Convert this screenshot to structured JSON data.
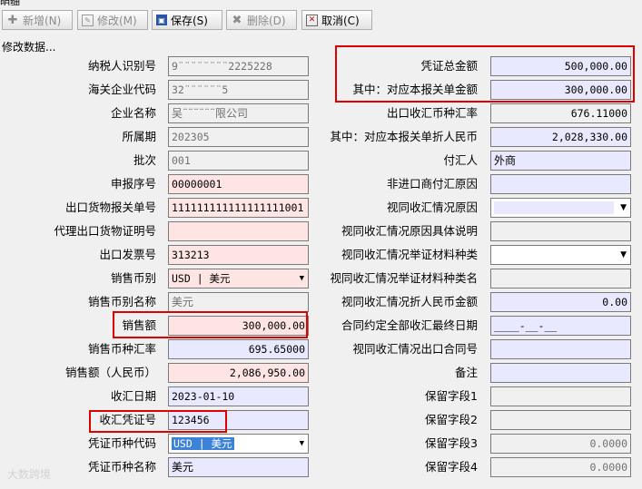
{
  "window": {
    "title": "明细"
  },
  "toolbar": {
    "add_label": "新增(N)",
    "edit_label": "修改(M)",
    "save_label": "保存(S)",
    "delete_label": "删除(D)",
    "cancel_label": "取消(C)"
  },
  "status_text": "修改数据...",
  "left_fields": [
    {
      "label": "纳税人识别号",
      "value": "9¨¨¨¨¨¨¨¨2225228"
    },
    {
      "label": "海关企业代码",
      "value": "32¨¨¨¨¨¨5"
    },
    {
      "label": "企业名称",
      "value": "吴¨¨¨¨¨¨限公司"
    },
    {
      "label": "所属期",
      "value": "202305"
    },
    {
      "label": "批次",
      "value": "001"
    },
    {
      "label": "申报序号",
      "value": "00000001"
    },
    {
      "label": "出口货物报关单号",
      "value": "111111111111111111001"
    },
    {
      "label": "代理出口货物证明号",
      "value": ""
    },
    {
      "label": "出口发票号",
      "value": "313213"
    },
    {
      "label": "销售币别",
      "value": "USD | 美元"
    },
    {
      "label": "销售币别名称",
      "value": "美元"
    },
    {
      "label": "销售额",
      "value": "300,000.00"
    },
    {
      "label": "销售币种汇率",
      "value": "695.65000"
    },
    {
      "label": "销售额（人民币）",
      "value": "2,086,950.00"
    },
    {
      "label": "收汇日期",
      "value": "2023-01-10"
    },
    {
      "label": "收汇凭证号",
      "value": "123456"
    },
    {
      "label": "凭证币种代码",
      "value": "USD | 美元"
    },
    {
      "label": "凭证币种名称",
      "value": "美元"
    }
  ],
  "right_fields": [
    {
      "label": "凭证总金额",
      "value": "500,000.00"
    },
    {
      "label": "其中：对应本报关单金额",
      "value": "300,000.00"
    },
    {
      "label": "出口收汇币种汇率",
      "value": "676.11000"
    },
    {
      "label": "其中：对应本报关单折人民币",
      "value": "2,028,330.00"
    },
    {
      "label": "付汇人",
      "value": "外商"
    },
    {
      "label": "非进口商付汇原因",
      "value": ""
    },
    {
      "label": "视同收汇情况原因",
      "value": ""
    },
    {
      "label": "视同收汇情况原因具体说明",
      "value": ""
    },
    {
      "label": "视同收汇情况举证材料种类",
      "value": ""
    },
    {
      "label": "视同收汇情况举证材料种类名",
      "value": ""
    },
    {
      "label": "视同收汇情况折人民币金额",
      "value": "0.00"
    },
    {
      "label": "合同约定全部收汇最终日期",
      "value": "____-__-__"
    },
    {
      "label": "视同收汇情况出口合同号",
      "value": ""
    },
    {
      "label": "备注",
      "value": ""
    },
    {
      "label": "保留字段1",
      "value": ""
    },
    {
      "label": "保留字段2",
      "value": ""
    },
    {
      "label": "保留字段3",
      "value": "0.0000"
    },
    {
      "label": "保留字段4",
      "value": "0.0000"
    }
  ],
  "colors": {
    "highlight": "#e00000",
    "required_bg": "#ffe4e4",
    "editable_bg": "#e8e8ff",
    "readonly_bg": "#f0f0f0"
  },
  "watermark": "大数跨境"
}
